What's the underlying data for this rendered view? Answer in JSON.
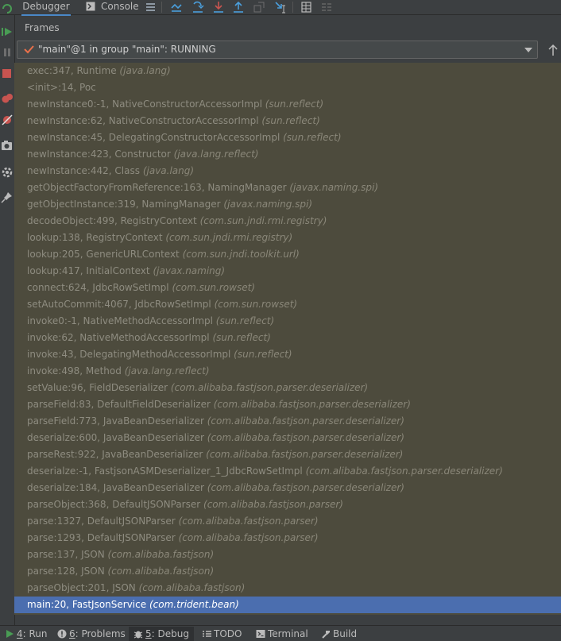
{
  "tabs": [
    {
      "label": "Debugger",
      "active": true
    },
    {
      "label": "Console",
      "active": false
    }
  ],
  "toolbar_icons": [
    "menu-icon",
    "show-execution-point-icon",
    "step-over-icon",
    "step-into-icon",
    "force-step-into-icon",
    "step-out-icon",
    "drop-frame-icon",
    "run-to-cursor-icon",
    "evaluate-icon",
    "restore-layout-icon"
  ],
  "gutter_icons": [
    "rerun-icon",
    "resume-icon",
    "pause-icon",
    "stop-icon",
    "view-breakpoints-icon",
    "mute-breakpoints-icon",
    "camera-icon",
    "settings-icon",
    "pin-icon"
  ],
  "frames_panel": {
    "title": "Frames",
    "thread": "\"main\"@1 in group \"main\": RUNNING"
  },
  "frames": [
    {
      "method": "exec:347, Runtime",
      "pkg": "(java.lang)"
    },
    {
      "method": "<init>:14, Poc",
      "pkg": ""
    },
    {
      "method": "newInstance0:-1, NativeConstructorAccessorImpl",
      "pkg": "(sun.reflect)"
    },
    {
      "method": "newInstance:62, NativeConstructorAccessorImpl",
      "pkg": "(sun.reflect)"
    },
    {
      "method": "newInstance:45, DelegatingConstructorAccessorImpl",
      "pkg": "(sun.reflect)"
    },
    {
      "method": "newInstance:423, Constructor",
      "pkg": "(java.lang.reflect)"
    },
    {
      "method": "newInstance:442, Class",
      "pkg": "(java.lang)"
    },
    {
      "method": "getObjectFactoryFromReference:163, NamingManager",
      "pkg": "(javax.naming.spi)"
    },
    {
      "method": "getObjectInstance:319, NamingManager",
      "pkg": "(javax.naming.spi)"
    },
    {
      "method": "decodeObject:499, RegistryContext",
      "pkg": "(com.sun.jndi.rmi.registry)"
    },
    {
      "method": "lookup:138, RegistryContext",
      "pkg": "(com.sun.jndi.rmi.registry)"
    },
    {
      "method": "lookup:205, GenericURLContext",
      "pkg": "(com.sun.jndi.toolkit.url)"
    },
    {
      "method": "lookup:417, InitialContext",
      "pkg": "(javax.naming)"
    },
    {
      "method": "connect:624, JdbcRowSetImpl",
      "pkg": "(com.sun.rowset)"
    },
    {
      "method": "setAutoCommit:4067, JdbcRowSetImpl",
      "pkg": "(com.sun.rowset)"
    },
    {
      "method": "invoke0:-1, NativeMethodAccessorImpl",
      "pkg": "(sun.reflect)"
    },
    {
      "method": "invoke:62, NativeMethodAccessorImpl",
      "pkg": "(sun.reflect)"
    },
    {
      "method": "invoke:43, DelegatingMethodAccessorImpl",
      "pkg": "(sun.reflect)"
    },
    {
      "method": "invoke:498, Method",
      "pkg": "(java.lang.reflect)"
    },
    {
      "method": "setValue:96, FieldDeserializer",
      "pkg": "(com.alibaba.fastjson.parser.deserializer)"
    },
    {
      "method": "parseField:83, DefaultFieldDeserializer",
      "pkg": "(com.alibaba.fastjson.parser.deserializer)"
    },
    {
      "method": "parseField:773, JavaBeanDeserializer",
      "pkg": "(com.alibaba.fastjson.parser.deserializer)"
    },
    {
      "method": "deserialze:600, JavaBeanDeserializer",
      "pkg": "(com.alibaba.fastjson.parser.deserializer)"
    },
    {
      "method": "parseRest:922, JavaBeanDeserializer",
      "pkg": "(com.alibaba.fastjson.parser.deserializer)"
    },
    {
      "method": "deserialze:-1, FastjsonASMDeserializer_1_JdbcRowSetImpl",
      "pkg": "(com.alibaba.fastjson.parser.deserializer)"
    },
    {
      "method": "deserialze:184, JavaBeanDeserializer",
      "pkg": "(com.alibaba.fastjson.parser.deserializer)"
    },
    {
      "method": "parseObject:368, DefaultJSONParser",
      "pkg": "(com.alibaba.fastjson.parser)"
    },
    {
      "method": "parse:1327, DefaultJSONParser",
      "pkg": "(com.alibaba.fastjson.parser)"
    },
    {
      "method": "parse:1293, DefaultJSONParser",
      "pkg": "(com.alibaba.fastjson.parser)"
    },
    {
      "method": "parse:137, JSON",
      "pkg": "(com.alibaba.fastjson)"
    },
    {
      "method": "parse:128, JSON",
      "pkg": "(com.alibaba.fastjson)"
    },
    {
      "method": "parseObject:201, JSON",
      "pkg": "(com.alibaba.fastjson)"
    },
    {
      "method": "main:20, FastJsonService",
      "pkg": "(com.trident.bean)",
      "selected": true
    }
  ],
  "bottom_tabs": [
    {
      "num": "4",
      "label": ": Run",
      "icon": "run-icon",
      "active": false
    },
    {
      "num": "6",
      "label": ": Problems",
      "icon": "problems-icon",
      "active": false
    },
    {
      "num": "5",
      "label": ": Debug",
      "icon": "debug-icon",
      "active": true
    },
    {
      "num": "",
      "label": "TODO",
      "icon": "todo-icon",
      "active": false
    },
    {
      "num": "",
      "label": "Terminal",
      "icon": "terminal-icon",
      "active": false
    },
    {
      "num": "",
      "label": "Build",
      "icon": "build-icon",
      "active": false
    }
  ],
  "colors": {
    "accent": "#4b6eaf",
    "frames_bg": "#4d4b3d",
    "check": "#e8704a",
    "green": "#499c54",
    "red": "#c75450",
    "toolbar_blue": "#4a9edb"
  }
}
